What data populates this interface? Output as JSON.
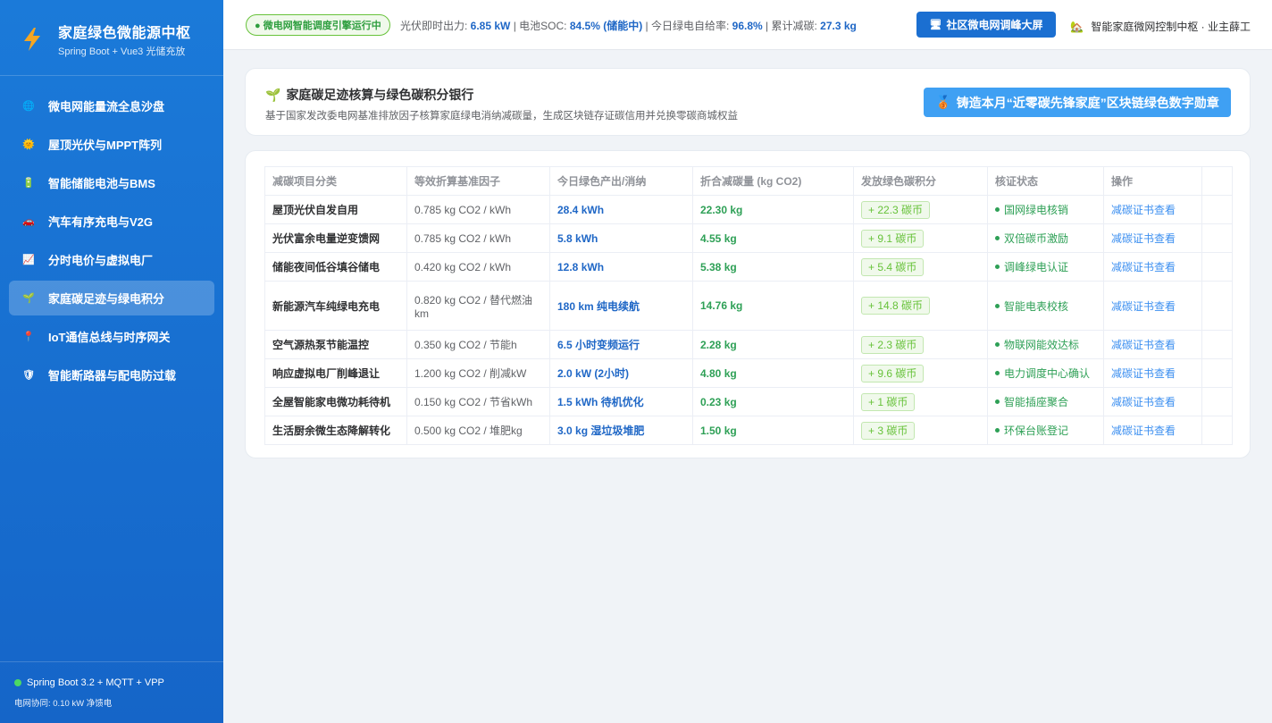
{
  "sidebar": {
    "brand_title": "家庭绿色微能源中枢",
    "brand_sub": "Spring Boot + Vue3 光储充放",
    "items": [
      {
        "label": "微电网能量流全息沙盘",
        "icon": "globe-icon",
        "glyph": "🌐"
      },
      {
        "label": "屋顶光伏与MPPT阵列",
        "icon": "sun-icon",
        "glyph": "🌞"
      },
      {
        "label": "智能储能电池与BMS",
        "icon": "battery-icon",
        "glyph": "🔋"
      },
      {
        "label": "汽车有序充电与V2G",
        "icon": "car-icon",
        "glyph": "🚗"
      },
      {
        "label": "分时电价与虚拟电厂",
        "icon": "chart-icon",
        "glyph": "📈"
      },
      {
        "label": "家庭碳足迹与绿电积分",
        "icon": "seedling-icon",
        "glyph": "🌱",
        "active": true
      },
      {
        "label": "IoT通信总线与时序网关",
        "icon": "antenna-icon",
        "glyph": "📍"
      },
      {
        "label": "智能断路器与配电防过载",
        "icon": "shield-icon",
        "glyph": "🛡"
      }
    ],
    "footer_line1": "Spring Boot 3.2 + MQTT + VPP",
    "footer_line2": "电网协同: 0.10 kW 净馈电"
  },
  "header": {
    "status": "● 微电网智能调度引擎运行中",
    "m1_label": "光伏即时出力: ",
    "m1_value": "6.85 kW",
    "m2_label": " | 电池SOC: ",
    "m2_value": "84.5% (储能中)",
    "m3_label": " | 今日绿电自给率: ",
    "m3_value": "96.8%",
    "m4_label": " | 累计减碳: ",
    "m4_value": "27.3 kg",
    "screen_button": "社区微电网调峰大屏",
    "screen_glyph": "🖥",
    "user": "智能家庭微网控制中枢 · 业主薛工",
    "user_glyph": "🏡"
  },
  "panel": {
    "title": "家庭碳足迹核算与绿色碳积分银行",
    "title_glyph": "🌱",
    "subtitle": "基于国家发改委电网基准排放因子核算家庭绿电消纳减碳量，生成区块链存证碳信用并兑换零碳商城权益",
    "mint_button": "铸造本月“近零碳先锋家庭”区块链绿色数字勋章",
    "mint_glyph": "🥉"
  },
  "table": {
    "headers": [
      "减碳项目分类",
      "等效折算基准因子",
      "今日绿色产出/消纳",
      "折合减碳量 (kg CO2)",
      "发放绿色碳积分",
      "核证状态",
      "操作"
    ],
    "rows": [
      {
        "item": "屋顶光伏自发自用",
        "factor": "0.785 kg CO2 / kWh",
        "output": "28.4 kWh",
        "reduction": "22.30 kg",
        "coins": "+ 22.3 碳币",
        "status": "国网绿电核销",
        "action": "减碳证书查看"
      },
      {
        "item": "光伏富余电量逆变馈网",
        "factor": "0.785 kg CO2 / kWh",
        "output": "5.8 kWh",
        "reduction": "4.55 kg",
        "coins": "+ 9.1 碳币",
        "status": "双倍碳币激励",
        "action": "减碳证书查看"
      },
      {
        "item": "储能夜间低谷填谷储电",
        "factor": "0.420 kg CO2 / kWh",
        "output": "12.8 kWh",
        "reduction": "5.38 kg",
        "coins": "+ 5.4 碳币",
        "status": "调峰绿电认证",
        "action": "减碳证书查看"
      },
      {
        "item": "新能源汽车纯绿电充电",
        "factor": "0.820 kg CO2 / 替代燃油km",
        "output": "180 km 纯电续航",
        "reduction": "14.76 kg",
        "coins": "+ 14.8 碳币",
        "status": "智能电表校核",
        "action": "减碳证书查看",
        "tall": true
      },
      {
        "item": "空气源热泵节能温控",
        "factor": "0.350 kg CO2 / 节能h",
        "output": "6.5 小时变频运行",
        "reduction": "2.28 kg",
        "coins": "+ 2.3 碳币",
        "status": "物联网能效达标",
        "action": "减碳证书查看"
      },
      {
        "item": "响应虚拟电厂削峰退让",
        "factor": "1.200 kg CO2 / 削减kW",
        "output": "2.0 kW (2小时)",
        "reduction": "4.80 kg",
        "coins": "+ 9.6 碳币",
        "status": "电力调度中心确认",
        "action": "减碳证书查看"
      },
      {
        "item": "全屋智能家电微功耗待机",
        "factor": "0.150 kg CO2 / 节省kWh",
        "output": "1.5 kWh 待机优化",
        "reduction": "0.23 kg",
        "coins": "+ 1 碳币",
        "status": "智能插座聚合",
        "action": "减碳证书查看"
      },
      {
        "item": "生活厨余微生态降解转化",
        "factor": "0.500 kg CO2 / 堆肥kg",
        "output": "3.0 kg 湿垃圾堆肥",
        "reduction": "1.50 kg",
        "coins": "+ 3 碳币",
        "status": "环保台账登记",
        "action": "减碳证书查看"
      }
    ]
  },
  "colors": {
    "sidebar": "#1b7ad9",
    "accent": "#1f67c6",
    "green": "#2ea056"
  }
}
